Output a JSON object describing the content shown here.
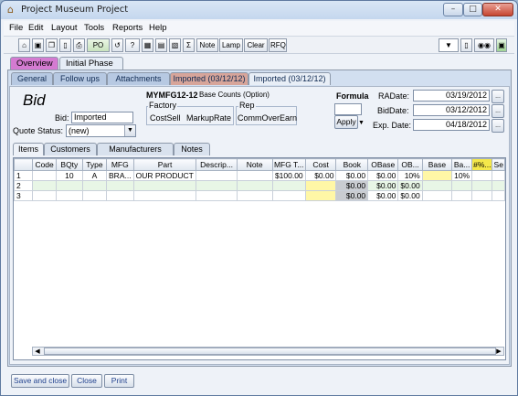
{
  "window": {
    "title": "Project Museum Project"
  },
  "menu": [
    "File",
    "Edit",
    "Layout",
    "Tools",
    "Reports",
    "Help"
  ],
  "toolbar": {
    "text_buttons": [
      "Note",
      "Lamp",
      "Clear",
      "RFQ"
    ],
    "po_label": "PO"
  },
  "main_tabs": [
    "Overview",
    "Initial Phase"
  ],
  "sub_tabs": [
    "General",
    "Follow ups",
    "Attachments",
    "Imported (03/12/12)",
    "Imported (03/12/12)"
  ],
  "header": {
    "bid_title": "Bid",
    "bid_label": "Bid:",
    "bid_value": "Imported",
    "quote_status_label": "Quote Status:",
    "quote_status_value": "(new)",
    "mfg_code": "MYMFG12-12",
    "base_counts": "Base Counts (Option)",
    "factory_title": "Factory",
    "factory_items": [
      "CostSell",
      "MarkupRate"
    ],
    "rep_title": "Rep",
    "rep_items": [
      "CommOverEarn"
    ],
    "formula_label": "Formula",
    "apply_label": "Apply",
    "dates": [
      {
        "label": "RADate:",
        "value": "03/19/2012"
      },
      {
        "label": "BidDate:",
        "value": "03/12/2012"
      },
      {
        "label": "Exp. Date:",
        "value": "04/18/2012"
      }
    ],
    "date_button": "..."
  },
  "item_tabs": [
    "Items",
    "Customers",
    "Manufacturers",
    "Notes"
  ],
  "grid": {
    "columns": [
      "",
      "Code",
      "BQty",
      "Type",
      "MFG",
      "Part",
      "Descrip...",
      "Note",
      "MFG T...",
      "Cost",
      "Book",
      "OBase",
      "OB...",
      "Base",
      "Ba...",
      "#%...",
      "Se"
    ],
    "rows": [
      [
        "1",
        "",
        "10",
        "A",
        "BRA...",
        "OUR PRODUCT",
        "",
        "",
        "$100.00",
        "$0.00",
        "$0.00",
        "$0.00",
        "10%",
        "",
        "10%",
        "",
        ""
      ],
      [
        "2",
        "",
        "",
        "",
        "",
        "",
        "",
        "",
        "",
        "",
        "$0.00",
        "$0.00",
        "$0.00",
        "",
        "",
        "",
        ""
      ],
      [
        "3",
        "",
        "",
        "",
        "",
        "",
        "",
        "",
        "",
        "",
        "$0.00",
        "$0.00",
        "$0.00",
        "",
        "",
        "",
        ""
      ]
    ]
  },
  "footer": {
    "save_close": "Save and close",
    "close": "Close",
    "print": "Print"
  }
}
